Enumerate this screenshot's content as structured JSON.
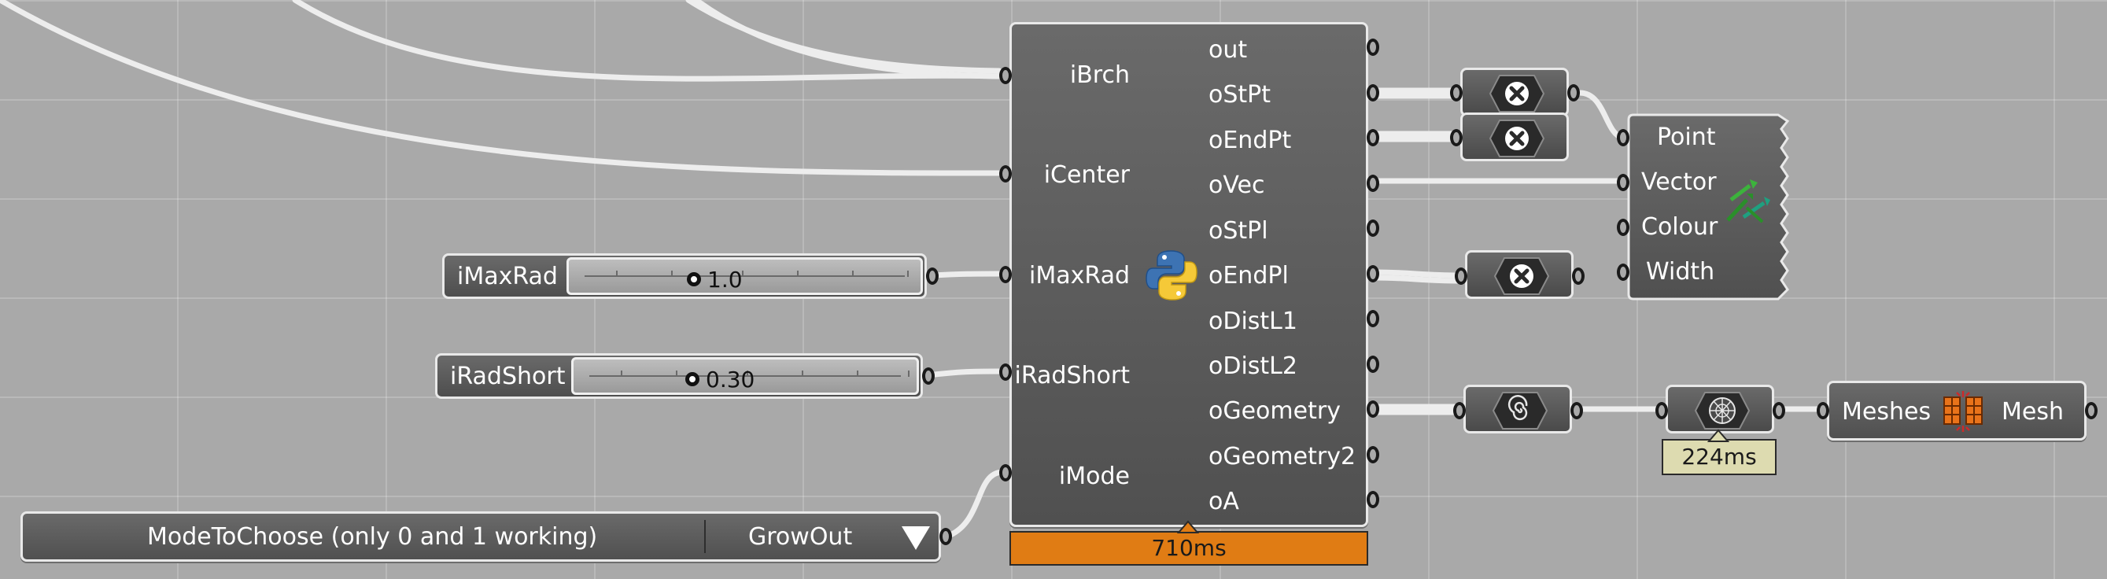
{
  "python_component": {
    "inputs": [
      "iBrch",
      "iCenter",
      "iMaxRad",
      "iRadShort",
      "iMode"
    ],
    "outputs": [
      "out",
      "oStPt",
      "oEndPt",
      "oVec",
      "oStPl",
      "oEndPl",
      "oDistL1",
      "oDistL2",
      "oGeometry",
      "oGeometry2",
      "oA"
    ],
    "timing": "710ms",
    "icon": "python-logo-icon"
  },
  "sliders": {
    "max_rad": {
      "name": "iMaxRad",
      "value": "1.0"
    },
    "rad_short": {
      "name": "iRadShort",
      "value": "0.30"
    }
  },
  "value_list": {
    "label": "ModeToChoose  (only 0 and 1 working)",
    "selected": "GrowOut"
  },
  "vector_display": {
    "inputs": [
      "Point",
      "Vector",
      "Colour",
      "Width"
    ],
    "icon": "vector-display-icon"
  },
  "mesh_component": {
    "input": "Meshes",
    "output": "Mesh",
    "icon": "mesh-join-icon"
  },
  "timers": {
    "mesh_settings": "224ms"
  },
  "small_components": {
    "disabled_1": "close-icon",
    "disabled_2": "close-icon",
    "disabled_3": "close-icon",
    "spiral": "spiral-icon",
    "sphere": "sphere-mesh-icon"
  },
  "colors": {
    "canvas": "#a9a9a9",
    "component_body": "#585858",
    "component_border": "#e9e9e9",
    "wire": "#ededed",
    "timer_warning": "#e07c14",
    "timer_tag": "#dddbb0"
  }
}
